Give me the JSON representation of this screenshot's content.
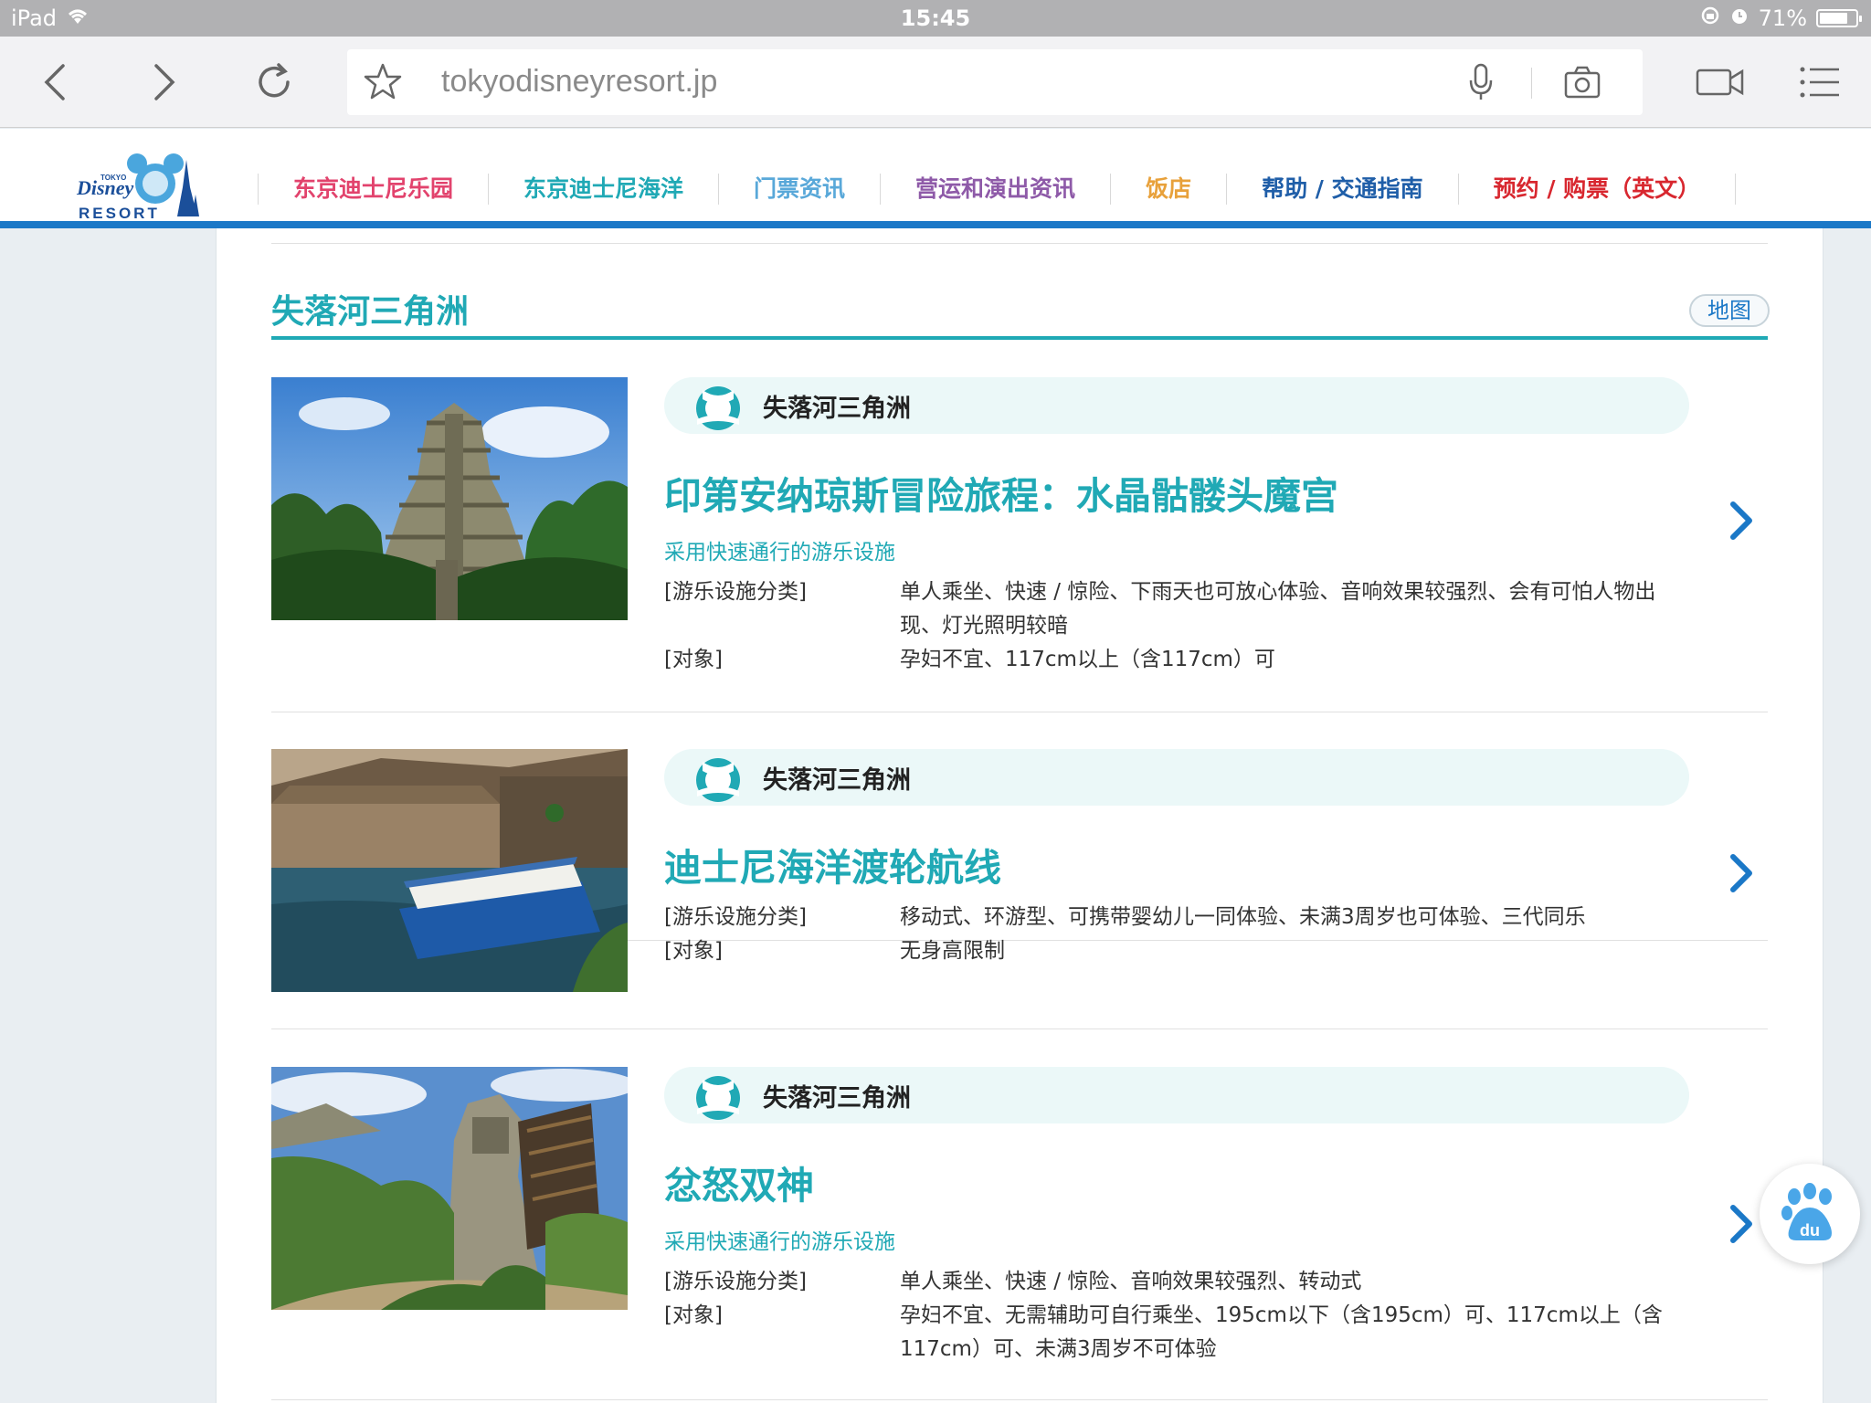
{
  "status_bar": {
    "device": "iPad",
    "time": "15:45",
    "battery": "71%",
    "battery_level": 0.71
  },
  "browser": {
    "url": "tokyodisneyresort.jp",
    "icons": [
      "back-icon",
      "forward-icon",
      "reload-icon",
      "bookmark-star-icon",
      "microphone-icon",
      "camera-icon",
      "video-icon",
      "menu-icon"
    ]
  },
  "site": {
    "logo_text": "TOKYO Disney RESORT",
    "nav": [
      {
        "label": "东京迪士尼乐园",
        "color": "#e2436d"
      },
      {
        "label": "东京迪士尼海洋",
        "color": "#20a9b5"
      },
      {
        "label": "门票资讯",
        "color": "#59a8d9"
      },
      {
        "label": "营运和演出资讯",
        "color": "#8e5aa8"
      },
      {
        "label": "饭店",
        "color": "#e8a13b"
      },
      {
        "label": "帮助 / 交通指南",
        "color": "#1f5ea8"
      },
      {
        "label": "预约 / 购票（英文）",
        "color": "#d8272f"
      }
    ]
  },
  "area": {
    "title": "失落河三角洲",
    "map_button": "地图"
  },
  "attractions": [
    {
      "area": "失落河三角洲",
      "name": "印第安纳琼斯冒险旅程：水晶骷髅头魔宫",
      "fastpass": "采用快速通行的游乐设施",
      "category_label": "[游乐设施分类]",
      "category": "单人乘坐、快速 / 惊险、下雨天也可放心体验、音响效果较强烈、会有可怕人物出现、灯光照明较暗",
      "target_label": "[对象]",
      "target": "孕妇不宜、117cm以上（含117cm）可",
      "image": "temple-pyramid-photo"
    },
    {
      "area": "失落河三角洲",
      "name": "迪士尼海洋渡轮航线",
      "fastpass": "",
      "category_label": "[游乐设施分类]",
      "category": "移动式、环游型、可携带婴幼儿一同体验、未满3周岁也可体验、三代同乐",
      "target_label": "[对象]",
      "target": "无身高限制",
      "image": "ferry-boat-photo"
    },
    {
      "area": "失落河三角洲",
      "name": "忿怒双神",
      "fastpass": "采用快速通行的游乐设施",
      "category_label": "[游乐设施分类]",
      "category": "单人乘坐、快速 / 惊险、音响效果较强烈、转动式",
      "target_label": "[对象]",
      "target": "孕妇不宜、无需辅助可自行乘坐、195cm以下（含195cm）可、117cm以上（含117cm）可、未满3周岁不可体验",
      "image": "ruins-coaster-photo"
    }
  ],
  "floating": {
    "baidu_label": "du"
  }
}
